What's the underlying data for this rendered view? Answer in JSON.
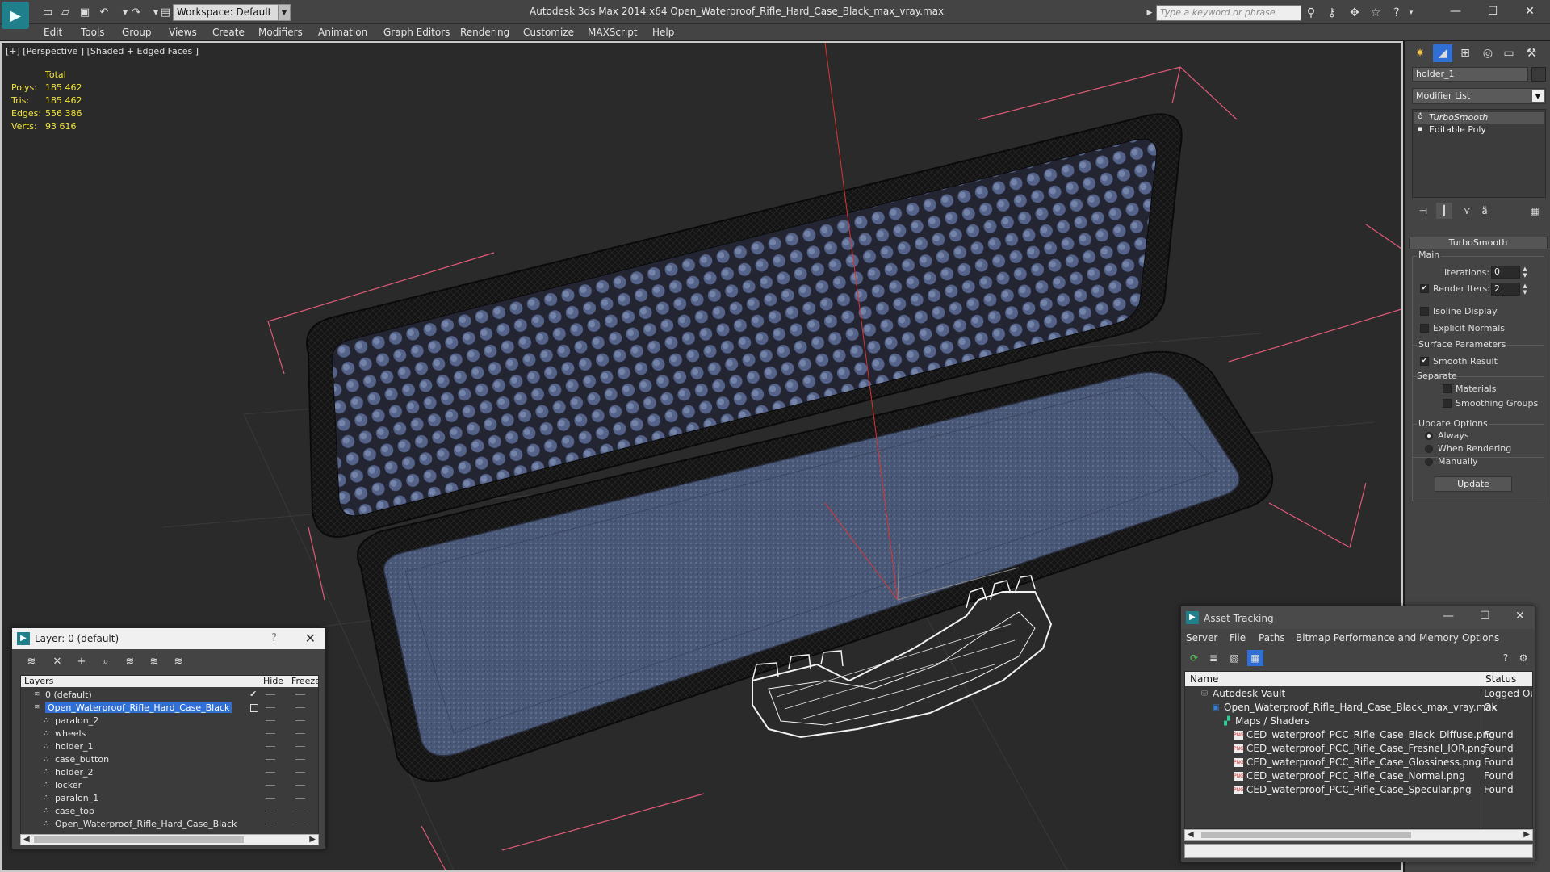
{
  "app": {
    "title": "Autodesk 3ds Max  2014 x64     Open_Waterproof_Rifle_Hard_Case_Black_max_vray.max",
    "workspace": "Workspace: Default",
    "search_placeholder": "Type a keyword or phrase"
  },
  "menu": [
    "Edit",
    "Tools",
    "Group",
    "Views",
    "Create",
    "Modifiers",
    "Animation",
    "Graph Editors",
    "Rendering",
    "Customize",
    "MAXScript",
    "Help"
  ],
  "viewport": {
    "label": "[+] [Perspective ] [Shaded + Edged Faces ]",
    "stats": {
      "header": "Total",
      "rows": [
        {
          "label": "Polys:",
          "value": "185 462"
        },
        {
          "label": "Tris:",
          "value": "185 462"
        },
        {
          "label": "Edges:",
          "value": "556 386"
        },
        {
          "label": "Verts:",
          "value": "93 616"
        }
      ]
    }
  },
  "command_panel": {
    "object_name": "holder_1",
    "modifier_list": "Modifier List",
    "stack": [
      "TurboSmooth",
      "Editable Poly"
    ],
    "rollout": "TurboSmooth",
    "main_label": "Main",
    "iterations_label": "Iterations:",
    "iterations_value": "0",
    "render_iters_label": "Render Iters:",
    "render_iters_value": "2",
    "isoline": "Isoline Display",
    "explicit_normals": "Explicit Normals",
    "surface_params": "Surface Parameters",
    "smooth_result": "Smooth Result",
    "separate": "Separate",
    "materials": "Materials",
    "smoothing_groups": "Smoothing Groups",
    "update_options": "Update Options",
    "always": "Always",
    "when_rendering": "When Rendering",
    "manually": "Manually",
    "update_button": "Update"
  },
  "layer_dialog": {
    "title": "Layer: 0 (default)",
    "help": "?",
    "columns": [
      "Layers",
      "Hide",
      "Freeze"
    ],
    "rows": [
      {
        "name": "0 (default)",
        "level": 0
      },
      {
        "name": "Open_Waterproof_Rifle_Hard_Case_Black",
        "level": 0,
        "selected": true
      },
      {
        "name": "paralon_2",
        "level": 1
      },
      {
        "name": "wheels",
        "level": 1
      },
      {
        "name": "holder_1",
        "level": 1
      },
      {
        "name": "case_button",
        "level": 1
      },
      {
        "name": "holder_2",
        "level": 1
      },
      {
        "name": "locker",
        "level": 1
      },
      {
        "name": "paralon_1",
        "level": 1
      },
      {
        "name": "case_top",
        "level": 1
      },
      {
        "name": "Open_Waterproof_Rifle_Hard_Case_Black",
        "level": 1
      }
    ]
  },
  "asset_tracking": {
    "title": "Asset Tracking",
    "menu": [
      "Server",
      "File",
      "Paths",
      "Bitmap Performance and Memory",
      "Options"
    ],
    "columns": [
      "Name",
      "Status"
    ],
    "rows": [
      {
        "name": "Autodesk Vault",
        "status": "Logged Ou",
        "level": 0,
        "icon": "vault"
      },
      {
        "name": "Open_Waterproof_Rifle_Hard_Case_Black_max_vray.max",
        "status": "Ok",
        "level": 1,
        "icon": "file"
      },
      {
        "name": "Maps / Shaders",
        "status": "",
        "level": 2,
        "icon": "maps"
      },
      {
        "name": "CED_waterproof_PCC_Rifle_Case_Black_Diffuse.png",
        "status": "Found",
        "level": 3,
        "icon": "png"
      },
      {
        "name": "CED_waterproof_PCC_Rifle_Case_Fresnel_IOR.png",
        "status": "Found",
        "level": 3,
        "icon": "png"
      },
      {
        "name": "CED_waterproof_PCC_Rifle_Case_Glossiness.png",
        "status": "Found",
        "level": 3,
        "icon": "png"
      },
      {
        "name": "CED_waterproof_PCC_Rifle_Case_Normal.png",
        "status": "Found",
        "level": 3,
        "icon": "png"
      },
      {
        "name": "CED_waterproof_PCC_Rifle_Case_Specular.png",
        "status": "Found",
        "level": 3,
        "icon": "png"
      }
    ]
  },
  "colors": {
    "accent": "#1f7f8a",
    "selection": "#2f6fd6",
    "stats": "#f2e43a",
    "foam": "#4a5878",
    "bbox": "#e05a78"
  }
}
